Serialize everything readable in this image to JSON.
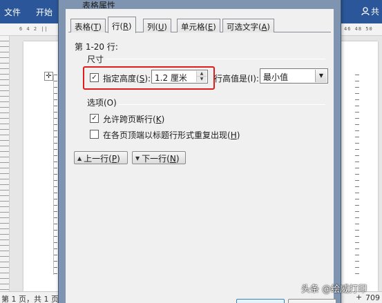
{
  "word": {
    "tabs": [
      "文件",
      "开始"
    ],
    "share_label": "共",
    "ruler_left": "6  4  2  ||",
    "ruler_right": "46  48  50",
    "status_page": "第 1 页，共 1 页",
    "status_plus": "+",
    "status_zoom": "709",
    "watermark": "头条 @绘威打印"
  },
  "dialog": {
    "title": "表格属性",
    "tabs": [
      {
        "label": "表格",
        "key": "T"
      },
      {
        "label": "行",
        "key": "R"
      },
      {
        "label": "列",
        "key": "U"
      },
      {
        "label": "单元格",
        "key": "E"
      },
      {
        "label": "可选文字",
        "key": "A"
      }
    ],
    "active_tab": "行",
    "range_label": "第 1-20 行:",
    "size_section": "尺寸",
    "specify_height": {
      "label": "指定高度",
      "key": "S",
      "suffix": ":",
      "checked": true
    },
    "height_value": "1.2 厘米",
    "height_rule_label": "行高值是(I):",
    "height_rule_value": "最小值",
    "options_section": "选项(O)",
    "allow_break": {
      "label": "允许跨页断行",
      "key": "K",
      "checked": true
    },
    "repeat_header": {
      "label": "在各页顶端以标题行形式重复出现",
      "key": "H",
      "checked": false
    },
    "prev_row": {
      "label": "上一行",
      "key": "P"
    },
    "next_row": {
      "label": "下一行",
      "key": "N"
    }
  },
  "colors": {
    "ribbon": "#2b579a",
    "highlight": "#e11a1a",
    "dialog_frame": "#7e94b1"
  }
}
